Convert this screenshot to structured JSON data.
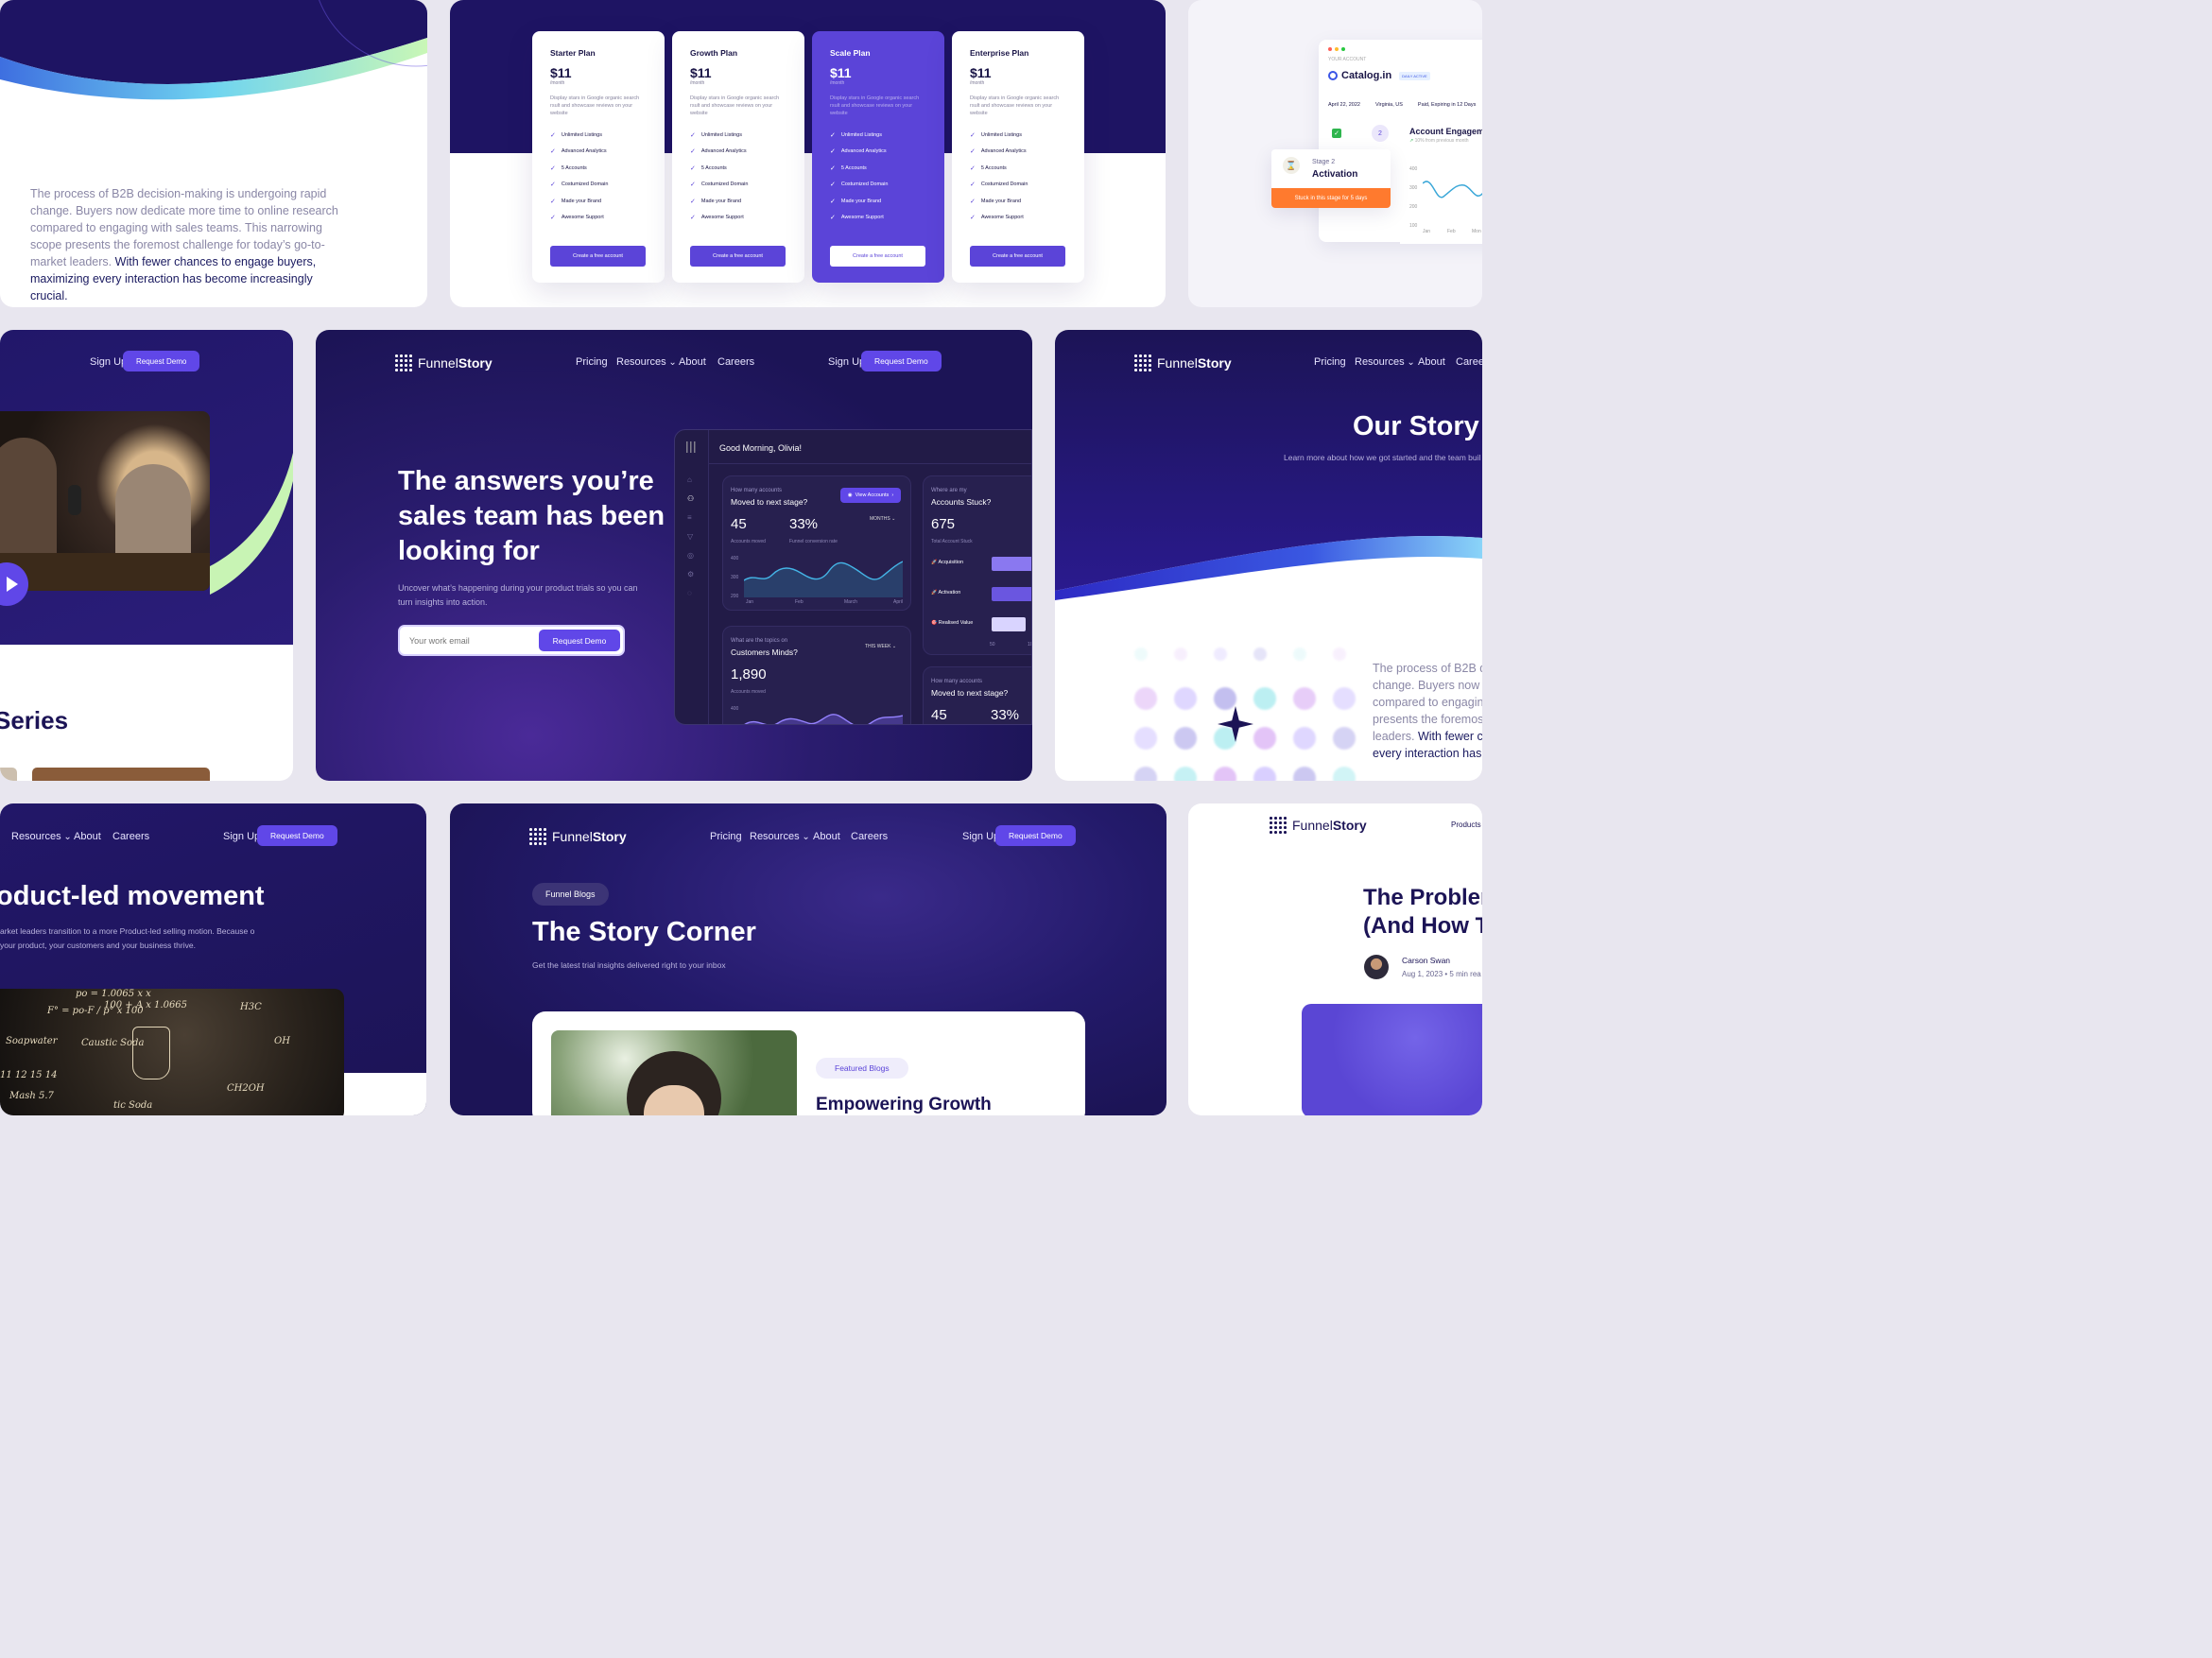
{
  "nav": {
    "brand_prefix": "Funnel",
    "brand_suffix": "Story",
    "pricing": "Pricing",
    "resources": "Resources",
    "about": "About",
    "careers": "Careers",
    "signup": "Sign Up",
    "request_demo": "Request Demo",
    "products": "Products"
  },
  "card_intro": {
    "body_muted": "The process of B2B decision-making is undergoing rapid change. Buyers now dedicate more time to online research compared to engaging with sales teams. This narrowing scope presents the foremost challenge for today’s go-to-market leaders.",
    "body_strong": "With fewer chances to engage buyers, maximizing every interaction has become increasingly crucial."
  },
  "pricing": {
    "plans": [
      {
        "name": "Starter Plan",
        "price": "$11",
        "period": "/month"
      },
      {
        "name": "Growth Plan",
        "price": "$11",
        "period": "/month"
      },
      {
        "name": "Scale Plan",
        "price": "$11",
        "period": "/month"
      },
      {
        "name": "Enterprise Plan",
        "price": "$11",
        "period": "/month"
      }
    ],
    "description": "Display stars in Google organic search rsult and showcase reviews on your website",
    "features": [
      "Unlimited Listings",
      "Advanced Analytics",
      "5 Accounts",
      "Costumized Domain",
      "Made your Brand",
      "Awesome Support"
    ],
    "cta": "Create a free account"
  },
  "account_card": {
    "your_account": "YOUR ACCOUNT",
    "company": "Catalog.in",
    "badge": "DAILY ACTIVE",
    "date": "April 22, 2022",
    "location": "Virginia, US",
    "plan_status": "Paid, Expiring in 12 Days",
    "step_number": "2",
    "stage_label": "Stage 2",
    "stage_name": "Activation",
    "stuck_notice": "Stuck in this stage for 5 days",
    "engagement_title": "Account Engageme",
    "engagement_delta": "10% from previous month",
    "y_ticks": [
      "400",
      "300",
      "200",
      "100"
    ],
    "x_ticks": [
      "Jan",
      "Feb",
      "Mon"
    ]
  },
  "podcast_card": {
    "series_fragment": "Series"
  },
  "hero": {
    "headline": "The answers you’re sales team has been looking for",
    "subtext": "Uncover what’s happening during your product trials so you can turn insights into action.",
    "email_placeholder": "Your work email",
    "cta": "Request Demo"
  },
  "dashboard": {
    "greeting": "Good Morning, Olivia!",
    "moved": {
      "caption": "How many accounts",
      "title": "Moved to next stage?",
      "view_btn": "View Accounts",
      "period": "MONTHS",
      "accounts_value": "45",
      "accounts_label": "Accounts moved",
      "conversion_value": "33%",
      "conversion_label": "Funnel conversion rate",
      "y_ticks": [
        "400",
        "300",
        "200"
      ],
      "x_ticks": [
        "Jan",
        "Feb",
        "March",
        "April"
      ]
    },
    "stuck": {
      "caption": "Where are my",
      "title": "Accounts Stuck?",
      "value": "675",
      "label": "Total Account Stuck",
      "stages": [
        "Acquisition",
        "Activation",
        "Realised Value"
      ],
      "x_ticks": [
        "50",
        "10"
      ],
      "cut_value": "8"
    },
    "minds": {
      "caption": "What are the topics on",
      "title": "Customers Minds?",
      "period": "THIS WEEK",
      "value": "1,890",
      "label": "Accounts moved",
      "y_tick": "400"
    },
    "moved2": {
      "caption": "How many accounts",
      "title": "Moved to next stage?",
      "accounts_value": "45",
      "conversion_value": "33%"
    }
  },
  "story_card": {
    "title": "Our Story",
    "subtitle": "Learn more about how we got started and the team buil",
    "body_muted": "The process of B2B de change. Buyers now d compared to engaging presents the foremost leaders.",
    "body_strong": "With fewer ch every interaction has b"
  },
  "movement_card": {
    "headline": "oduct-led movement",
    "body": "arket leaders transition to a more Product-led selling motion. Because o your product, your customers and your business thrive.",
    "chalk": [
      "po = 1.0065 x x",
      "100 + A x 1.0665",
      "F° = po-F / p°  x 100",
      "Soapwater",
      "Caustic Soda",
      "H3C",
      "OH",
      "CH2OH",
      "11  12  15  14",
      "Mash 5.7",
      "tic Soda"
    ]
  },
  "blog_card": {
    "pill": "Funnel Blogs",
    "title": "The Story Corner",
    "subtitle": "Get the latest trial insights delivered right to your inbox",
    "featured": "Featured Blogs",
    "post_title": "Empowering Growth"
  },
  "article_card": {
    "title_line1": "The Probler",
    "title_line2": "(And How T",
    "author": "Carson Swan",
    "meta": "Aug 1, 2023 • 5 min rea"
  }
}
